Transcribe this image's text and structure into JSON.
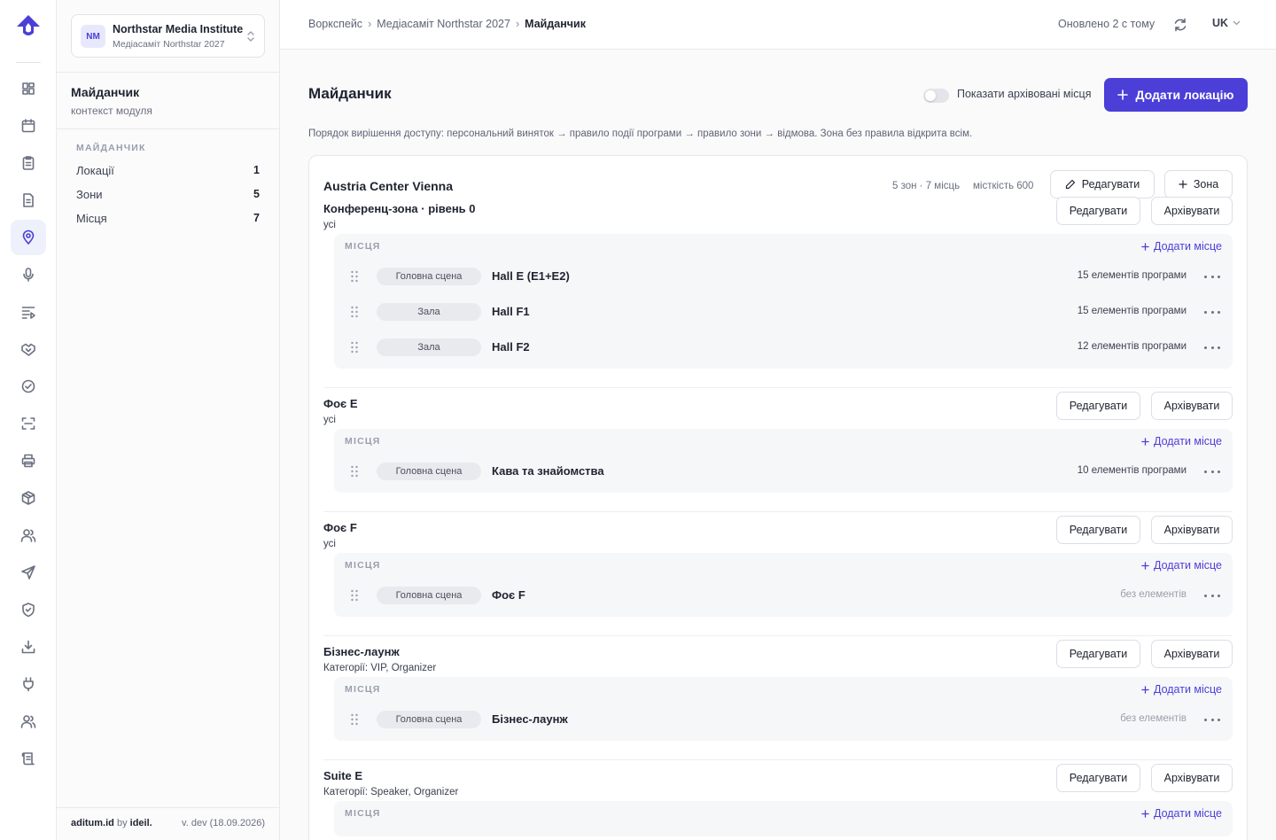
{
  "nav": {
    "items": [
      {
        "name": "dashboard-icon"
      },
      {
        "name": "calendar-icon"
      },
      {
        "name": "clipboard-icon"
      },
      {
        "name": "document-icon"
      },
      {
        "name": "location-pin-icon",
        "active": true
      },
      {
        "name": "microphone-icon"
      },
      {
        "name": "agenda-list-icon"
      },
      {
        "name": "handshake-icon"
      },
      {
        "name": "check-circle-icon"
      },
      {
        "name": "scan-icon"
      },
      {
        "name": "printer-icon"
      },
      {
        "name": "package-icon"
      },
      {
        "name": "users-icon"
      },
      {
        "name": "send-icon"
      },
      {
        "name": "shield-check-icon"
      },
      {
        "name": "download-icon"
      },
      {
        "name": "plug-icon"
      },
      {
        "name": "people-icon"
      },
      {
        "name": "scroll-icon"
      }
    ]
  },
  "org": {
    "badge": "NM",
    "name": "Northstar Media Institute",
    "event": "Медіасаміт Northstar 2027"
  },
  "module": {
    "title": "Майданчик",
    "subtitle": "контекст модуля",
    "group": "МАЙДАНЧИК",
    "items": [
      {
        "label": "Локації",
        "count": "1"
      },
      {
        "label": "Зони",
        "count": "5"
      },
      {
        "label": "Місця",
        "count": "7"
      }
    ]
  },
  "footer": {
    "brand": "aditum.id",
    "by": "by",
    "vendor": "ideil.",
    "version": "v. dev (18.09.2026)"
  },
  "topbar": {
    "crumbs": [
      "Воркспейс",
      "Медіасаміт Northstar 2027",
      "Майданчик"
    ],
    "sep": "›",
    "updated": "Оновлено 2 с тому",
    "lang": "UK"
  },
  "page": {
    "title": "Майданчик",
    "show_archived": "Показати архівовані місця",
    "add_location": "Додати локацію",
    "hint": "Порядок вирішення доступу: персональний виняток → правило події програми → правило зони → відмова. Зона без правила відкрита всім."
  },
  "location": {
    "name": "Austria Center Vienna",
    "meta": "5 зон · 7 місць",
    "capacity": "місткість 600",
    "edit": "Редагувати",
    "add_zone": "Зона"
  },
  "labels": {
    "edit": "Редагувати",
    "archive": "Архівувати",
    "places": "МІСЦЯ",
    "add_place": "Додати місце"
  },
  "zones": [
    {
      "name": "Конференц-зона · рівень 0",
      "access": "усі",
      "places": [
        {
          "tag": "Головна сцена",
          "name": "Hall E (E1+E2)",
          "count": "15 елементів програми"
        },
        {
          "tag": "Зала",
          "name": "Hall F1",
          "count": "15 елементів програми"
        },
        {
          "tag": "Зала",
          "name": "Hall F2",
          "count": "12 елементів програми"
        }
      ]
    },
    {
      "name": "Фоє E",
      "access": "усі",
      "places": [
        {
          "tag": "Головна сцена",
          "name": "Кава та знайомства",
          "count": "10 елементів програми"
        }
      ]
    },
    {
      "name": "Фоє F",
      "access": "усі",
      "places": [
        {
          "tag": "Головна сцена",
          "name": "Фоє F",
          "count": "без елементів",
          "muted": true
        }
      ]
    },
    {
      "name": "Бізнес-лаунж",
      "access": "Категорії: VIP, Organizer",
      "places": [
        {
          "tag": "Головна сцена",
          "name": "Бізнес-лаунж",
          "count": "без елементів",
          "muted": true
        }
      ]
    },
    {
      "name": "Suite E",
      "access": "Категорії: Speaker, Organizer",
      "places": []
    }
  ],
  "colors": {
    "accent": "#4b3fd8",
    "active_bg": "#eef0fb"
  }
}
